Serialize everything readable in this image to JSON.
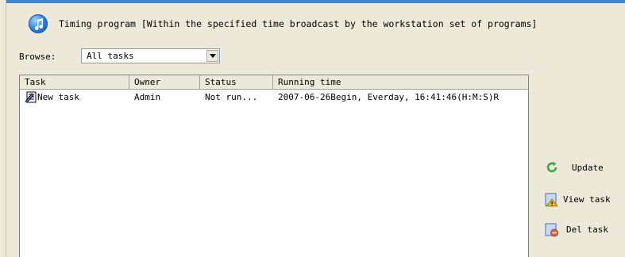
{
  "header": {
    "title": "Timing program [Within the specified time broadcast by the workstation set of programs]"
  },
  "browse": {
    "label": "Browse:",
    "selected": "All tasks"
  },
  "table": {
    "columns": [
      "Task",
      "Owner",
      "Status",
      "Running time"
    ],
    "rows": [
      {
        "task": "New task",
        "owner": "Admin",
        "status": "Not run...",
        "running_time": "2007-06-26Begin, Everday, 16:41:46(H:M:S)R"
      }
    ]
  },
  "actions": {
    "update": "Update",
    "view_task": "View task",
    "del_task": "Del task"
  },
  "colors": {
    "accent": "#3a86d6",
    "background": "#ece9d8",
    "update_icon": "#3aa845",
    "view_icon": "#f2b705",
    "del_icon": "#e8603c"
  }
}
